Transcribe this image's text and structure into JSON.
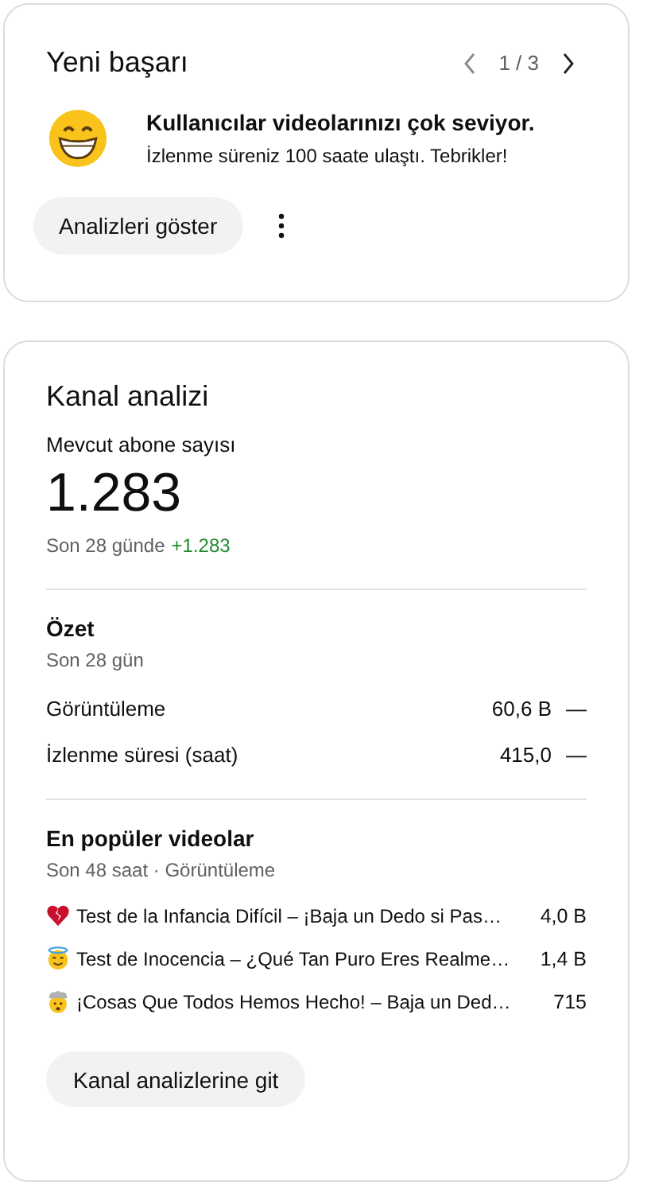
{
  "achievement_card": {
    "title": "Yeni başarı",
    "pager": "1 / 3",
    "headline": "Kullanıcılar videolarınızı çok seviyor.",
    "message": "İzlenme süreniz 100 saate ulaştı. Tebrikler!",
    "button": "Analizleri göster"
  },
  "analytics_card": {
    "title": "Kanal analizi",
    "subscribers_label": "Mevcut abone sayısı",
    "subscribers": "1.283",
    "period_label": "Son 28 günde",
    "change": "+1.283",
    "summary": {
      "title": "Özet",
      "subtitle": "Son 28 gün",
      "rows": [
        {
          "label": "Görüntüleme",
          "value": "60,6 B",
          "trend": "—"
        },
        {
          "label": "İzlenme süresi (saat)",
          "value": "415,0",
          "trend": "—"
        }
      ]
    },
    "top_videos": {
      "title": "En popüler videolar",
      "subtitle": "Son 48 saat · Görüntüleme",
      "rows": [
        {
          "kind": "broken-heart",
          "title": "Test de la Infancia Difícil – ¡Baja un Dedo si Pas…",
          "views": "4,0 B"
        },
        {
          "kind": "halo",
          "title": "Test de Inocencia – ¿Qué Tan Puro Eres Realme…",
          "views": "1,4 B"
        },
        {
          "kind": "exploding",
          "title": "¡Cosas Que Todos Hemos Hecho! – Baja un Ded…",
          "views": "715"
        }
      ]
    },
    "button": "Kanal analizlerine git"
  }
}
